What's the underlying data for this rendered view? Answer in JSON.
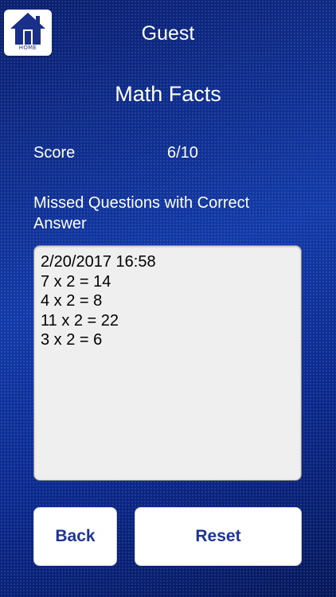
{
  "home": {
    "label": "HOME",
    "icon": "house-icon"
  },
  "header": {
    "user_name": "Guest",
    "title": "Math Facts"
  },
  "score": {
    "label": "Score",
    "value": "6/10"
  },
  "missed": {
    "heading": "Missed Questions with Correct Answer",
    "lines": [
      "2/20/2017 16:58",
      "7 x 2 = 14",
      "4 x 2 = 8",
      "11 x 2 = 22",
      "3 x 2 = 6"
    ]
  },
  "buttons": {
    "back_label": "Back",
    "reset_label": "Reset"
  },
  "colors": {
    "background": "#0d2a8c",
    "button_text": "#1f3593",
    "text_box_bg": "#efefef"
  }
}
